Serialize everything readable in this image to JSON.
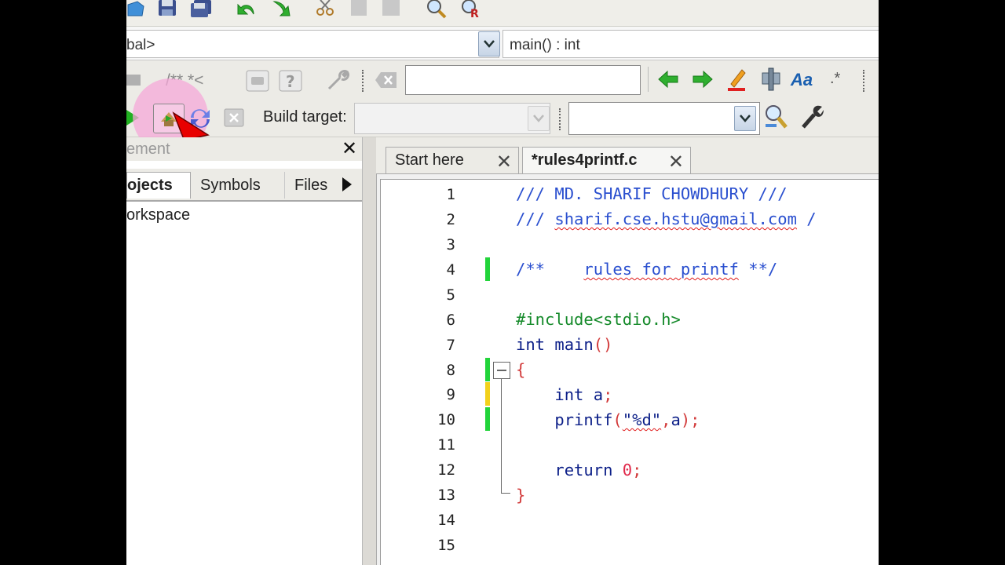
{
  "toolbar": {
    "scope_value": "bal>",
    "function_value": "main() : int",
    "doxy_label": "/**  *<",
    "regex_label": ".*",
    "match_case_label": "Aa",
    "build_target_label": "Build target:"
  },
  "management": {
    "title": "ement",
    "tabs": [
      {
        "label": "ojects"
      },
      {
        "label": "Symbols"
      },
      {
        "label": "Files"
      }
    ],
    "tree_root": "orkspace"
  },
  "editor": {
    "tabs": [
      {
        "label": "Start here"
      },
      {
        "label": "*rules4printf.c"
      }
    ],
    "line_numbers": [
      "1",
      "2",
      "3",
      "4",
      "5",
      "6",
      "7",
      "8",
      "9",
      "10",
      "11",
      "12",
      "13",
      "14",
      "15"
    ],
    "code": {
      "l1": "/// MD. SHARIF CHOWDHURY ///",
      "l2_a": "/// ",
      "l2_b": "sharif.cse.hstu@gmail.com",
      "l2_c": " /",
      "l4_a": "/**    ",
      "l4_b": "rules for printf",
      "l4_c": " **/",
      "l6": "#include<stdio.h>",
      "l7_a": "int main",
      "l7_b": "()",
      "l8": "{",
      "l9_a": "    int a",
      "l9_b": ";",
      "l10_a": "    printf",
      "l10_b": "(",
      "l10_c": "\"%d\"",
      "l10_d": ",",
      "l10_e": "a",
      "l10_f": ");",
      "l12_a": "    return ",
      "l12_b": "0",
      "l12_c": ";",
      "l13": "}"
    },
    "change_markers": {
      "green": [
        "4",
        "8",
        "10"
      ],
      "yellow": [
        "9"
      ]
    }
  },
  "colors": {
    "comment": "#2a4fcf",
    "preprocessor": "#158a2a",
    "keyword": "#0c1f88",
    "number": "#e0284a",
    "cursor_highlight": "#f5a8d8",
    "cursor": "#e00000"
  },
  "icons": [
    "open-icon",
    "save-icon",
    "save-all-icon",
    "undo-icon",
    "redo-icon",
    "cut-icon",
    "copy-icon",
    "paste-icon",
    "find-icon",
    "replace-icon",
    "run-icon",
    "build-icon",
    "rebuild-icon",
    "abort-icon",
    "arrow-left-icon",
    "arrow-right-icon",
    "highlight-icon",
    "selected-text-icon",
    "match-case-icon",
    "regex-icon",
    "magnifier-icon",
    "wrench-icon",
    "close-icon",
    "chevron-down-icon",
    "play-icon"
  ]
}
